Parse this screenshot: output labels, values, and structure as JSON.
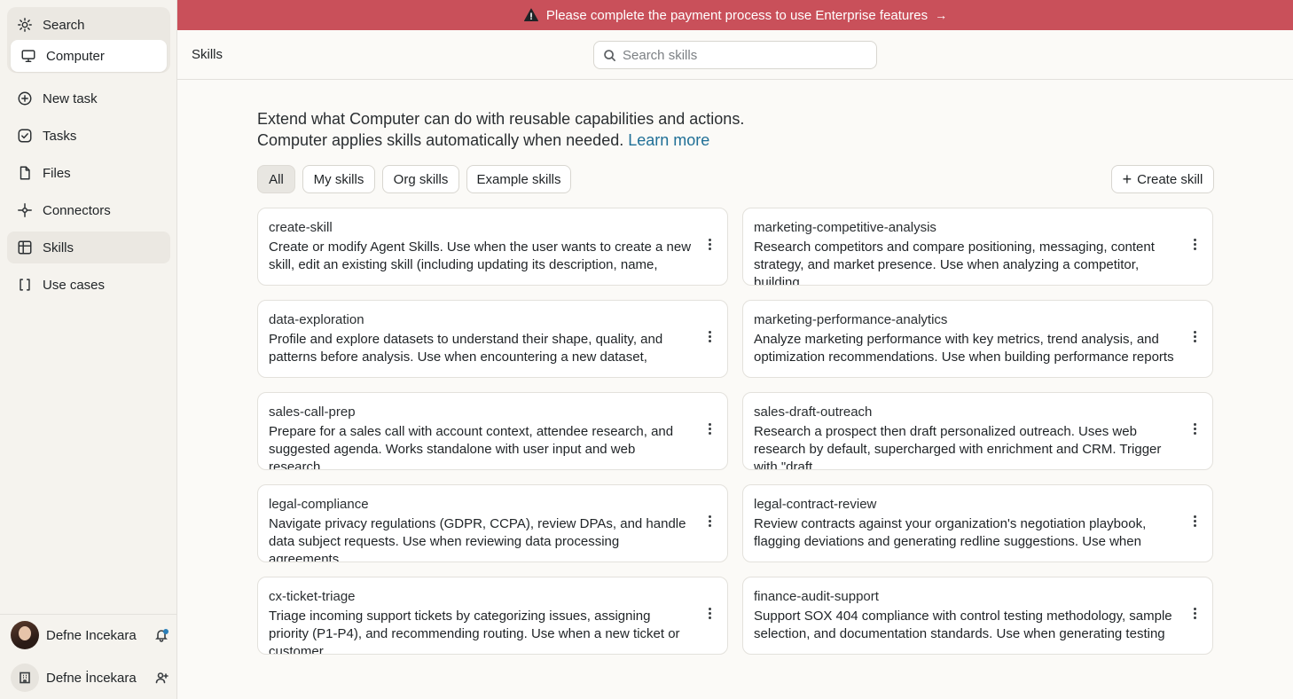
{
  "sidebar": {
    "search_label": "Search",
    "computer_label": "Computer",
    "new_task_label": "New task",
    "tasks_label": "Tasks",
    "files_label": "Files",
    "connectors_label": "Connectors",
    "skills_label": "Skills",
    "use_cases_label": "Use cases",
    "user_name": "Defne Incekara",
    "org_name": "Defne İncekara"
  },
  "banner": {
    "text": "Please complete the payment process to use Enterprise features",
    "arrow": "→",
    "color": "#c9505a"
  },
  "topbar": {
    "title": "Skills",
    "search_placeholder": "Search skills"
  },
  "intro": {
    "text": "Extend what Computer can do with reusable capabilities and actions. Computer applies skills automatically when needed.",
    "link": "Learn more"
  },
  "filters": {
    "all": "All",
    "my": "My skills",
    "org": "Org skills",
    "example": "Example skills",
    "create": "Create skill"
  },
  "skills": [
    {
      "name": "create-skill",
      "desc": "Create or modify Agent Skills. Use when the user wants to create a new skill, edit an existing skill (including updating its description, name,"
    },
    {
      "name": "marketing-competitive-analysis",
      "desc": "Research competitors and compare positioning, messaging, content strategy, and market presence. Use when analyzing a competitor, building"
    },
    {
      "name": "data-exploration",
      "desc": "Profile and explore datasets to understand their shape, quality, and patterns before analysis. Use when encountering a new dataset,"
    },
    {
      "name": "marketing-performance-analytics",
      "desc": "Analyze marketing performance with key metrics, trend analysis, and optimization recommendations. Use when building performance reports"
    },
    {
      "name": "sales-call-prep",
      "desc": "Prepare for a sales call with account context, attendee research, and suggested agenda. Works standalone with user input and web research,"
    },
    {
      "name": "sales-draft-outreach",
      "desc": "Research a prospect then draft personalized outreach. Uses web research by default, supercharged with enrichment and CRM. Trigger with \"draft"
    },
    {
      "name": "legal-compliance",
      "desc": "Navigate privacy regulations (GDPR, CCPA), review DPAs, and handle data subject requests. Use when reviewing data processing agreements,"
    },
    {
      "name": "legal-contract-review",
      "desc": "Review contracts against your organization's negotiation playbook, flagging deviations and generating redline suggestions. Use when"
    },
    {
      "name": "cx-ticket-triage",
      "desc": "Triage incoming support tickets by categorizing issues, assigning priority (P1-P4), and recommending routing. Use when a new ticket or customer"
    },
    {
      "name": "finance-audit-support",
      "desc": "Support SOX 404 compliance with control testing methodology, sample selection, and documentation standards. Use when generating testing"
    }
  ]
}
